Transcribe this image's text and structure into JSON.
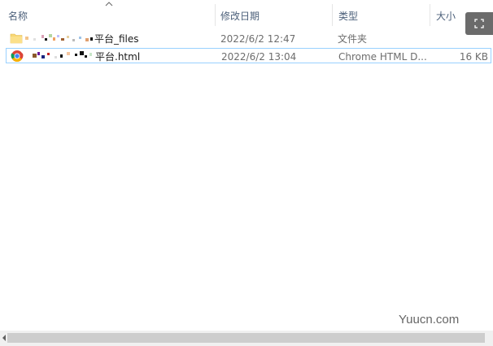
{
  "columns": {
    "name": "名称",
    "modified": "修改日期",
    "type": "类型",
    "size": "大小"
  },
  "sort": {
    "column": "name",
    "direction": "ascending"
  },
  "files": [
    {
      "name_suffix": "平台_files",
      "modified": "2022/6/2 12:47",
      "type": "文件夹",
      "size": "",
      "icon": "folder-icon",
      "selected": false
    },
    {
      "name_suffix": "平台.html",
      "modified": "2022/6/2 13:04",
      "type": "Chrome HTML D...",
      "size": "16 KB",
      "icon": "chrome-icon",
      "selected": true
    }
  ],
  "floating_button": {
    "icon": "expand-icon"
  },
  "watermark": "Yuucn.com",
  "colors": {
    "header_text": "#4c607a",
    "selection_border": "#99d1ff",
    "folder": "#f8d775",
    "scrollbar_track": "#f0f0f0",
    "scrollbar_thumb": "#cdcdcd"
  }
}
